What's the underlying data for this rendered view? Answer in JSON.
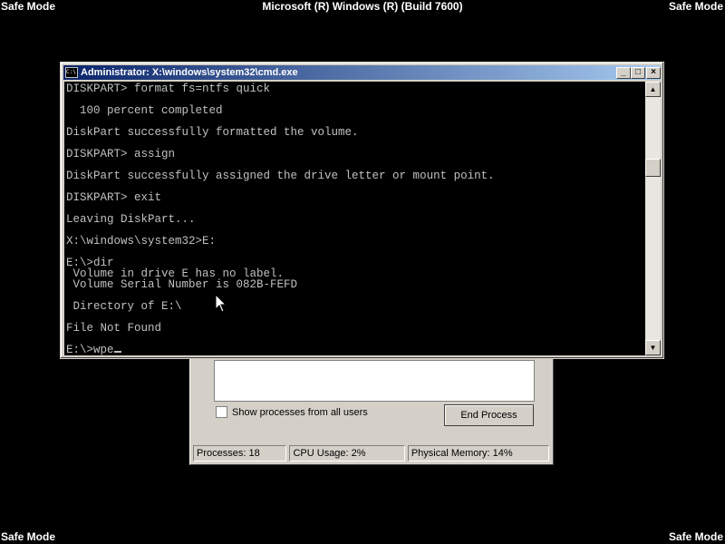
{
  "screen": {
    "corner_label": "Safe Mode",
    "banner": "Microsoft (R) Windows (R) (Build 7600)"
  },
  "cmd": {
    "title": "Administrator: X:\\windows\\system32\\cmd.exe",
    "lines": [
      "DISKPART> format fs=ntfs quick",
      "",
      "  100 percent completed",
      "",
      "DiskPart successfully formatted the volume.",
      "",
      "DISKPART> assign",
      "",
      "DiskPart successfully assigned the drive letter or mount point.",
      "",
      "DISKPART> exit",
      "",
      "Leaving DiskPart...",
      "",
      "X:\\windows\\system32>E:",
      "",
      "E:\\>dir",
      " Volume in drive E has no label.",
      " Volume Serial Number is 082B-FEFD",
      "",
      " Directory of E:\\",
      "",
      "File Not Found",
      "",
      "E:\\>wpe"
    ],
    "buttons": {
      "minimize": "_",
      "maximize": "□",
      "close": "×"
    },
    "scroll": {
      "up": "▲",
      "down": "▼"
    }
  },
  "taskmgr": {
    "checkbox_label": "Show processes from all users",
    "end_process": "End Process",
    "status": {
      "processes": "Processes: 18",
      "cpu": "CPU Usage: 2%",
      "memory": "Physical Memory: 14%"
    }
  },
  "colors": {
    "titlebar_start": "#0a246a",
    "titlebar_end": "#a6caf0",
    "console_text": "#c0c0c0"
  },
  "icons": {
    "cmd_window_icon": "cmd-icon",
    "mouse_pointer": "arrow-pointer"
  }
}
